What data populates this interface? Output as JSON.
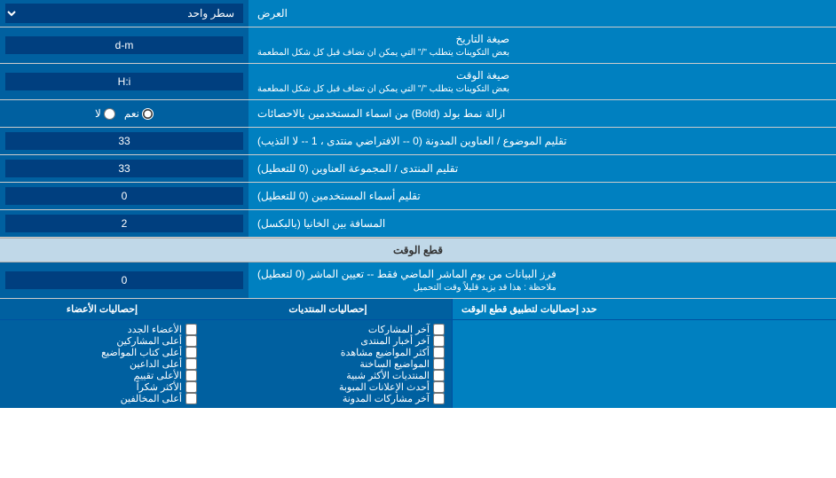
{
  "page": {
    "title": "العرض",
    "rows": [
      {
        "label": "العرض",
        "input_type": "select",
        "input_value": "سطر واحد"
      },
      {
        "label": "صيغة التاريخ\nبعض التكوينات يتطلب \"/\" التي يمكن ان تضاف قبل كل شكل المطعمة",
        "input_type": "text",
        "input_value": "d-m"
      },
      {
        "label": "صيغة الوقت\nبعض التكوينات يتطلب \"/\" التي يمكن ان تضاف قبل كل شكل المطعمة",
        "input_type": "text",
        "input_value": "H:i"
      },
      {
        "label": "ازالة نمط بولد (Bold) من اسماء المستخدمين بالاحصائات",
        "input_type": "radio",
        "radio_options": [
          "نعم",
          "لا"
        ],
        "radio_selected": "نعم"
      },
      {
        "label": "تقليم الموضوع / العناوين المدونة (0 -- الافتراضي منتدى ، 1 -- لا التذيب)",
        "input_type": "text",
        "input_value": "33"
      },
      {
        "label": "تقليم المنتدى / المجموعة العناوين (0 للتعطيل)",
        "input_type": "text",
        "input_value": "33"
      },
      {
        "label": "تقليم أسماء المستخدمين (0 للتعطيل)",
        "input_type": "text",
        "input_value": "0"
      },
      {
        "label": "المسافة بين الخانيا (بالبكسل)",
        "input_type": "text",
        "input_value": "2"
      }
    ],
    "section_cutoff": {
      "title": "قطع الوقت",
      "row": {
        "label": "فرز البيانات من يوم الماشر الماضي فقط -- تعيين الماشر (0 لتعطيل)\nملاحظة : هذا قد يزيد قليلاً وقت التحميل",
        "input_type": "text",
        "input_value": "0"
      },
      "limit_label": "حدد إحصاليات لتطبيق قطع الوقت"
    },
    "checkbox_columns": [
      {
        "header": "",
        "items": []
      },
      {
        "header": "إحصاليات المنتديات",
        "items": [
          "آخر المشاركات",
          "آخر أخبار المنتدى",
          "أكثر المواضيع مشاهدة",
          "المواضيع الساخنة",
          "المنتديات الأكثر شبية",
          "أحدث الإعلانات المبوبة",
          "آخر مشاركات المدونة"
        ]
      },
      {
        "header": "إحصاليات الأعضاء",
        "items": [
          "الأعضاء الجدد",
          "أعلى المشاركين",
          "أعلى كتاب المواضيع",
          "أعلى الداعين",
          "الأعلى تقييم",
          "الأكثر شكراً",
          "أعلى المخالفين"
        ]
      }
    ]
  }
}
